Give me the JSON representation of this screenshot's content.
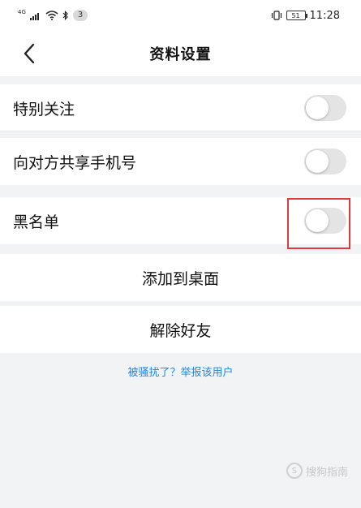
{
  "status_bar": {
    "network": "4G",
    "notification_count": "3",
    "battery": "51",
    "time": "11:28"
  },
  "header": {
    "title": "资料设置",
    "back_icon": "chevron-left-icon"
  },
  "settings": {
    "special_follow": {
      "label": "特别关注",
      "enabled": false
    },
    "share_phone": {
      "label": "向对方共享手机号",
      "enabled": false
    },
    "blacklist": {
      "label": "黑名单",
      "enabled": false
    }
  },
  "actions": {
    "add_to_desktop": "添加到桌面",
    "remove_friend": "解除好友"
  },
  "report_link": "被骚扰了？举报该用户",
  "watermark": {
    "text": "搜狗指南"
  },
  "colors": {
    "link": "#2a86d8",
    "highlight": "#e03a3a",
    "toggle_off": "#e4e4e4",
    "background": "#f2f3f5"
  }
}
